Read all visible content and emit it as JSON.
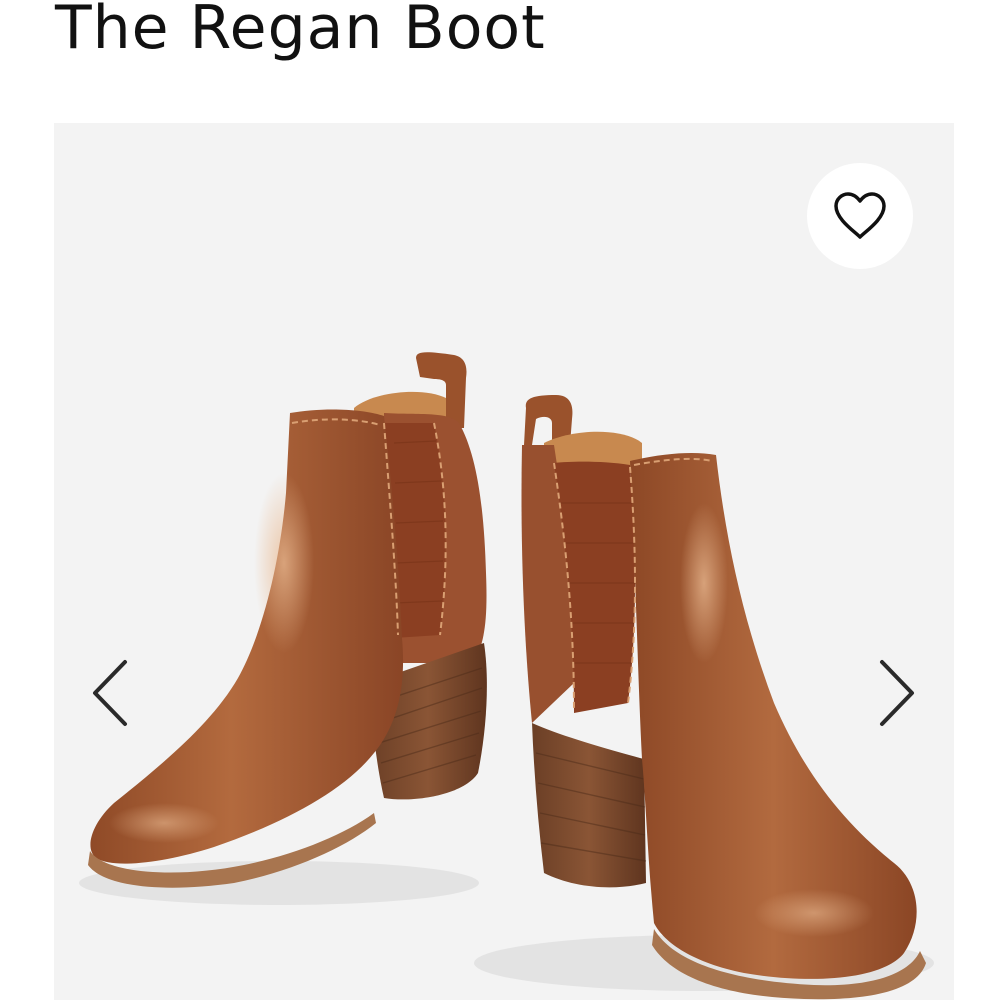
{
  "product": {
    "title": "The Regan Boot"
  },
  "gallery": {
    "image_subject": "ankle-boots",
    "background": "#f3f3f3",
    "leather_color": "#a0552e"
  },
  "controls": {
    "favorite_icon": "heart-outline-icon",
    "prev_icon": "chevron-left-icon",
    "next_icon": "chevron-right-icon"
  }
}
